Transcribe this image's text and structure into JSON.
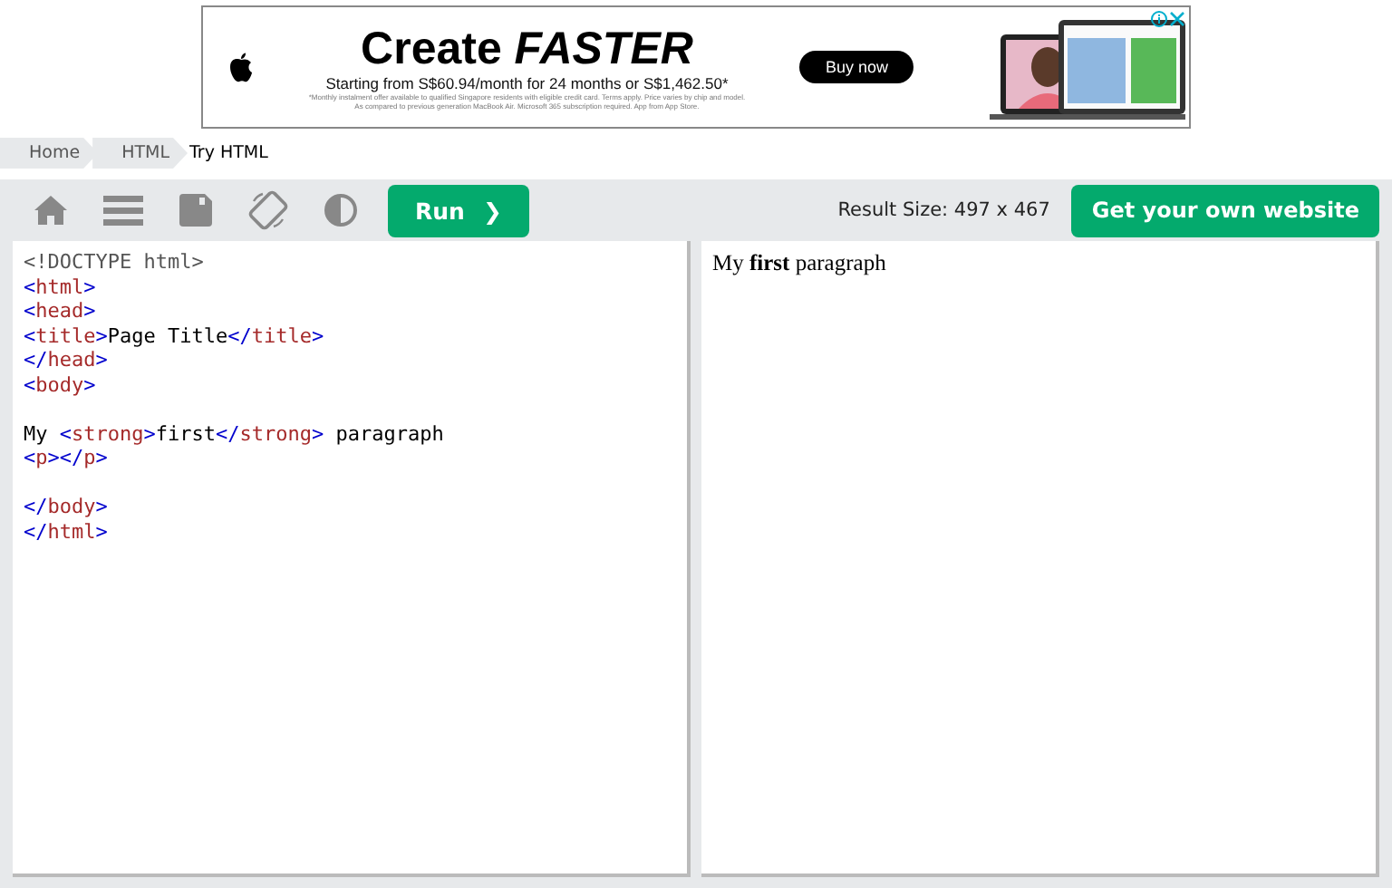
{
  "ad": {
    "headline": "Create *FASTER*",
    "subline": "Starting from S$60.94/month for 24 months or S$1,462.50*",
    "fine_print": [
      "*Monthly instalment offer available to qualified Singapore residents with eligible credit card. Terms apply. Price varies by chip and model.",
      "As compared to previous generation MacBook Air. Microsoft 365 subscription required. App from App Store."
    ],
    "button": "Buy now",
    "image": {
      "kind": "picture"
    }
  },
  "breadcrumb": [
    {
      "label": "Home",
      "current": false
    },
    {
      "label": "HTML",
      "current": false
    },
    {
      "label": "Try HTML",
      "current": true
    }
  ],
  "toolbar": {
    "tools": [
      {
        "kind": "home"
      },
      {
        "kind": "menu"
      },
      {
        "kind": "save"
      },
      {
        "kind": "rotate"
      },
      {
        "kind": "contrast"
      }
    ],
    "run_button": "Run",
    "run_icon": "❯",
    "result_size": "Result Size: 497 x 467",
    "cta_button": "Get your own website"
  },
  "editor": {
    "lines": [
      {
        "kind": "code",
        "tokens": [
          {
            "kind": "doctype",
            "text": "<!DOCTYPE html>"
          }
        ]
      },
      {
        "kind": "code",
        "tokens": [
          {
            "kind": "bracket",
            "text": "<"
          },
          {
            "kind": "tag",
            "text": "html"
          },
          {
            "kind": "bracket",
            "text": ">"
          }
        ]
      },
      {
        "kind": "code",
        "tokens": [
          {
            "kind": "bracket",
            "text": "<"
          },
          {
            "kind": "tag",
            "text": "head"
          },
          {
            "kind": "bracket",
            "text": ">"
          }
        ]
      },
      {
        "kind": "code",
        "tokens": [
          {
            "kind": "bracket",
            "text": "<"
          },
          {
            "kind": "tag",
            "text": "title"
          },
          {
            "kind": "bracket",
            "text": ">"
          },
          {
            "kind": "text",
            "text": "Page Title"
          },
          {
            "kind": "bracket",
            "text": "</"
          },
          {
            "kind": "tag",
            "text": "title"
          },
          {
            "kind": "bracket",
            "text": ">"
          }
        ]
      },
      {
        "kind": "code",
        "tokens": [
          {
            "kind": "bracket",
            "text": "</"
          },
          {
            "kind": "tag",
            "text": "head"
          },
          {
            "kind": "bracket",
            "text": ">"
          }
        ]
      },
      {
        "kind": "code",
        "tokens": [
          {
            "kind": "bracket",
            "text": "<"
          },
          {
            "kind": "tag",
            "text": "body"
          },
          {
            "kind": "bracket",
            "text": ">"
          }
        ]
      },
      {
        "kind": "blank"
      },
      {
        "kind": "code",
        "tokens": [
          {
            "kind": "text",
            "text": "My "
          },
          {
            "kind": "bracket",
            "text": "<"
          },
          {
            "kind": "tag",
            "text": "strong"
          },
          {
            "kind": "bracket",
            "text": ">"
          },
          {
            "kind": "text",
            "text": "first"
          },
          {
            "kind": "bracket",
            "text": "</"
          },
          {
            "kind": "tag",
            "text": "strong"
          },
          {
            "kind": "bracket",
            "text": ">"
          },
          {
            "kind": "text",
            "text": " paragraph"
          }
        ]
      },
      {
        "kind": "code",
        "tokens": [
          {
            "kind": "bracket",
            "text": "<"
          },
          {
            "kind": "tag",
            "text": "p"
          },
          {
            "kind": "bracket",
            "text": "></"
          },
          {
            "kind": "tag",
            "text": "p"
          },
          {
            "kind": "bracket",
            "text": ">"
          }
        ]
      },
      {
        "kind": "blank"
      },
      {
        "kind": "code",
        "tokens": [
          {
            "kind": "bracket",
            "text": "</"
          },
          {
            "kind": "tag",
            "text": "body"
          },
          {
            "kind": "bracket",
            "text": ">"
          }
        ]
      },
      {
        "kind": "code",
        "tokens": [
          {
            "kind": "bracket",
            "text": "</"
          },
          {
            "kind": "tag",
            "text": "html"
          },
          {
            "kind": "bracket",
            "text": ">"
          }
        ]
      }
    ]
  },
  "result": {
    "paragraph": "My **first** paragraph"
  }
}
